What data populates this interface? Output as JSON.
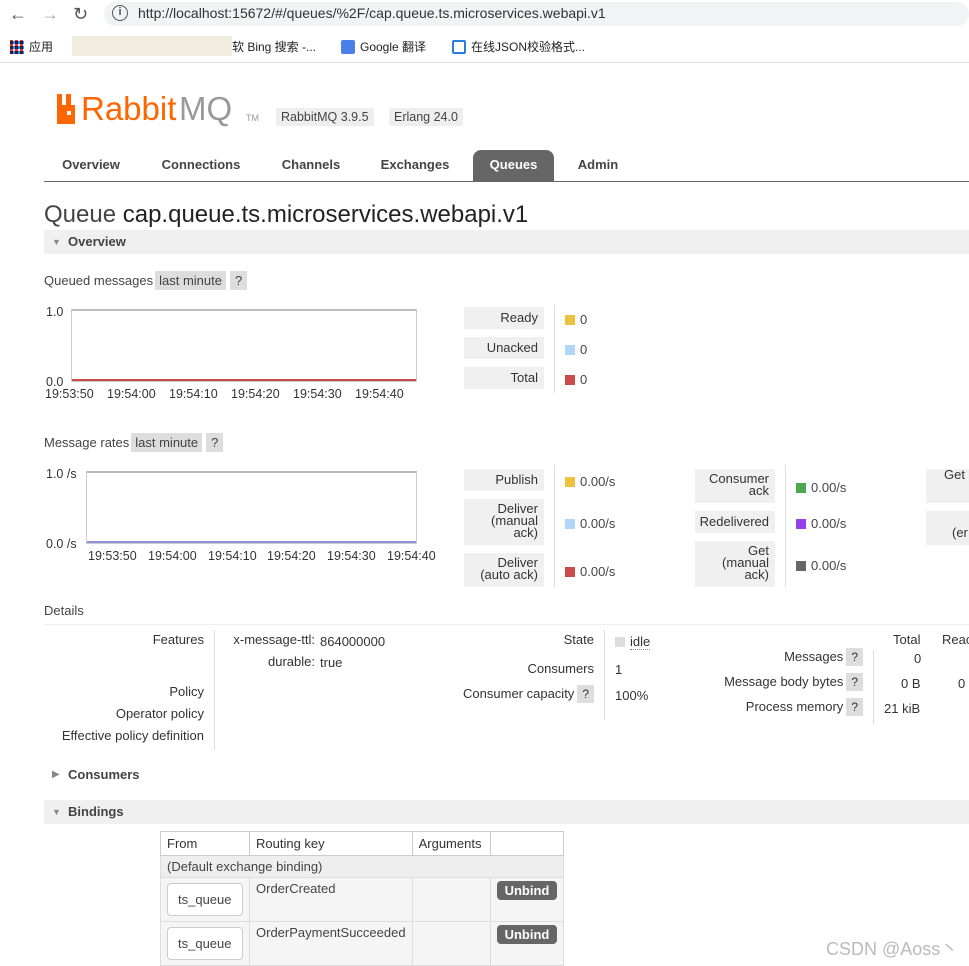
{
  "browser": {
    "back": "←",
    "forward": "→",
    "reload": "↻",
    "info": "i",
    "url": "http://localhost:15672/#/queues/%2F/cap.queue.ts.microservices.webapi.v1"
  },
  "bookmarks": {
    "apps": "应用",
    "bing": "软 Bing 搜索 -...",
    "google": "Google 翻译",
    "json": "在线JSON校验格式..."
  },
  "header": {
    "logo": "RabbitMQ",
    "tm": "TM",
    "version_rmq": "RabbitMQ 3.9.5",
    "version_erlang": "Erlang 24.0"
  },
  "tabs": [
    "Overview",
    "Connections",
    "Channels",
    "Exchanges",
    "Queues",
    "Admin"
  ],
  "title": {
    "prefix": "Queue",
    "name": "cap.queue.ts.microservices.webapi.v1"
  },
  "overview": {
    "section": "Overview",
    "queued_label": "Queued messages",
    "range": "last minute",
    "help": "?",
    "queued_chart": {
      "ymax": "1.0",
      "ymin": "0.0",
      "x": [
        "19:53:50",
        "19:54:00",
        "19:54:10",
        "19:54:20",
        "19:54:30",
        "19:54:40"
      ]
    },
    "queued_legend": [
      {
        "label": "Ready",
        "value": "0",
        "color": "#edc240"
      },
      {
        "label": "Unacked",
        "value": "0",
        "color": "#afd8f8"
      },
      {
        "label": "Total",
        "value": "0",
        "color": "#cb4b4b"
      }
    ],
    "rates_label": "Message rates",
    "rates_chart": {
      "ymax": "1.0 /s",
      "ymin": "0.0 /s",
      "x": [
        "19:53:50",
        "19:54:00",
        "19:54:10",
        "19:54:20",
        "19:54:30",
        "19:54:40"
      ]
    },
    "rates_col1": [
      {
        "label": "Publish",
        "value": "0.00/s",
        "color": "#edc240"
      },
      {
        "label": "Deliver (manual ack)",
        "value": "0.00/s",
        "color": "#afd8f8"
      },
      {
        "label": "Deliver (auto ack)",
        "value": "0.00/s",
        "color": "#cb4b4b"
      }
    ],
    "rates_col2": [
      {
        "label": "Consumer ack",
        "value": "0.00/s",
        "color": "#4da74d"
      },
      {
        "label": "Redelivered",
        "value": "0.00/s",
        "color": "#9440ed"
      },
      {
        "label": "Get (manual ack)",
        "value": "0.00/s",
        "color": "#666666"
      }
    ],
    "rates_col3": [
      "Get",
      "(er"
    ]
  },
  "details": {
    "label": "Details",
    "features": "Features",
    "ttl_key": "x-message-ttl:",
    "ttl_val": "864000000",
    "durable_key": "durable:",
    "durable_val": "true",
    "policy": "Policy",
    "op_policy": "Operator policy",
    "eff_policy": "Effective policy definition",
    "state_label": "State",
    "state_val": "idle",
    "consumers_label": "Consumers",
    "consumers_val": "1",
    "capacity_label": "Consumer capacity",
    "capacity_val": "100%",
    "total_hdr": "Total",
    "ready_hdr": "Reac",
    "messages": "Messages",
    "messages_total": "0",
    "body_bytes": "Message body bytes",
    "body_total": "0 B",
    "body_ready": "0",
    "proc_mem": "Process memory",
    "proc_total": "21 kiB"
  },
  "consumers_section": "Consumers",
  "bindings": {
    "section": "Bindings",
    "headers": [
      "From",
      "Routing key",
      "Arguments",
      ""
    ],
    "default_row": "(Default exchange binding)",
    "rows": [
      {
        "from": "ts_queue",
        "key": "OrderCreated",
        "action": "Unbind"
      },
      {
        "from": "ts_queue",
        "key": "OrderPaymentSucceeded",
        "action": "Unbind"
      }
    ]
  },
  "watermark": "CSDN @Aoss丶"
}
